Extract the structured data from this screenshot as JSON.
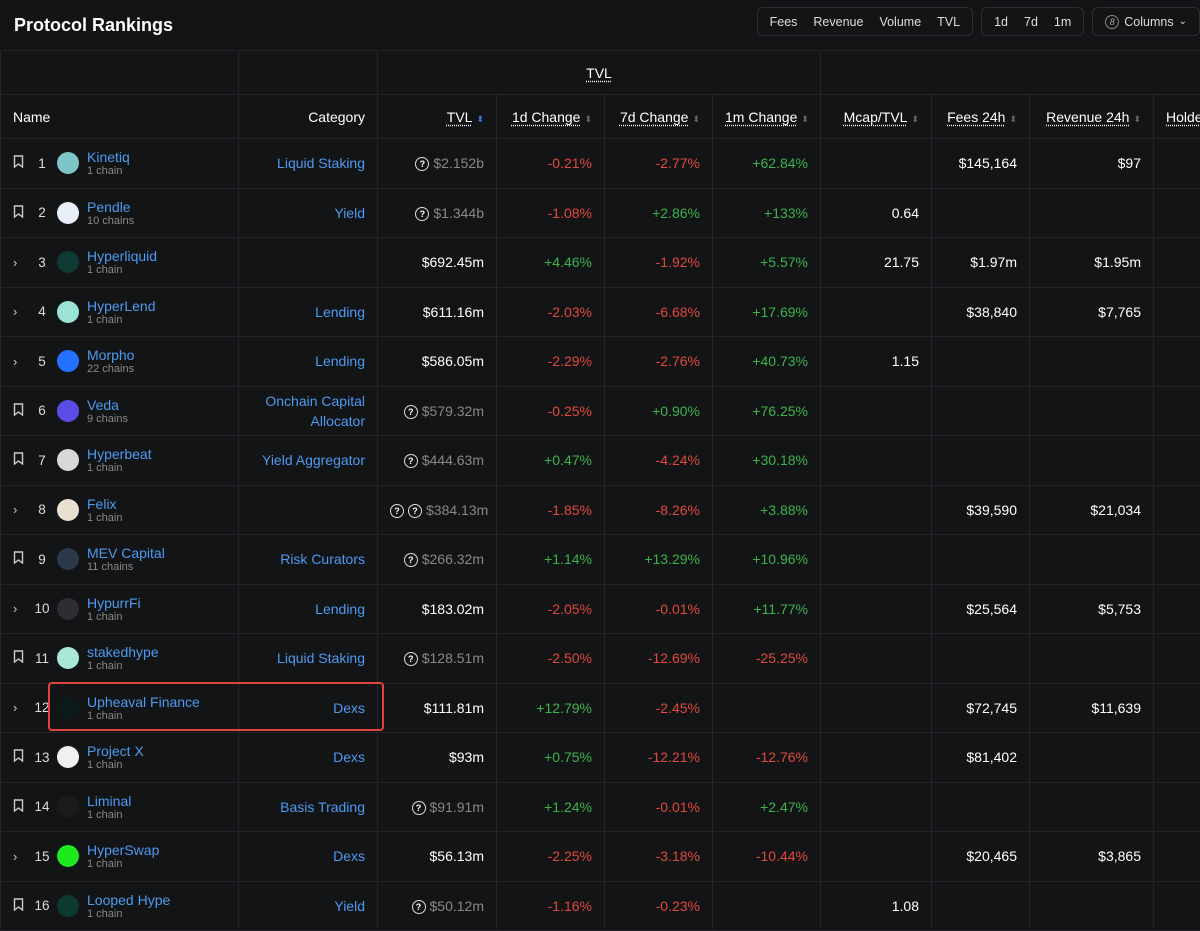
{
  "title": "Protocol Rankings",
  "metric_tabs": [
    "Fees",
    "Revenue",
    "Volume",
    "TVL"
  ],
  "period_tabs": [
    "1d",
    "7d",
    "1m"
  ],
  "columns_button": {
    "count": "8",
    "label": "Columns"
  },
  "group_header": "TVL",
  "headers": [
    "Name",
    "Category",
    "TVL",
    "1d Change",
    "7d Change",
    "1m Change",
    "Mcap/TVL",
    "Fees 24h",
    "Revenue 24h",
    "Holders"
  ],
  "rows": [
    {
      "icon": "bookmark",
      "rank": "1",
      "name": "Kinetiq",
      "chains": "1 chain",
      "cat": "Liquid Staking",
      "q": 1,
      "tvl": "$2.152b",
      "d1": "-0.21%",
      "d7": "-2.77%",
      "m1": "+62.84%",
      "mcap": "",
      "fees": "$145,164",
      "rev": "$97",
      "color": "#7fc4c9"
    },
    {
      "icon": "bookmark",
      "rank": "2",
      "name": "Pendle",
      "chains": "10 chains",
      "cat": "Yield",
      "q": 1,
      "tvl": "$1.344b",
      "d1": "-1.08%",
      "d7": "+2.86%",
      "m1": "+133%",
      "mcap": "0.64",
      "fees": "",
      "rev": "",
      "color": "#e8eef8"
    },
    {
      "icon": "chevron",
      "rank": "3",
      "name": "Hyperliquid",
      "chains": "1 chain",
      "cat": "",
      "q": 0,
      "tvl": "$692.45m",
      "d1": "+4.46%",
      "d7": "-1.92%",
      "m1": "+5.57%",
      "mcap": "21.75",
      "fees": "$1.97m",
      "rev": "$1.95m",
      "color": "#0f3a33"
    },
    {
      "icon": "chevron",
      "rank": "4",
      "name": "HyperLend",
      "chains": "1 chain",
      "cat": "Lending",
      "q": 0,
      "tvl": "$611.16m",
      "d1": "-2.03%",
      "d7": "-6.68%",
      "m1": "+17.69%",
      "mcap": "",
      "fees": "$38,840",
      "rev": "$7,765",
      "color": "#9be3d6"
    },
    {
      "icon": "chevron",
      "rank": "5",
      "name": "Morpho",
      "chains": "22 chains",
      "cat": "Lending",
      "q": 0,
      "tvl": "$586.05m",
      "d1": "-2.29%",
      "d7": "-2.76%",
      "m1": "+40.73%",
      "mcap": "1.15",
      "fees": "",
      "rev": "",
      "color": "#2470ff"
    },
    {
      "icon": "bookmark",
      "rank": "6",
      "name": "Veda",
      "chains": "9 chains",
      "cat": "Onchain Capital Allocator",
      "q": 1,
      "tvl": "$579.32m",
      "d1": "-0.25%",
      "d7": "+0.90%",
      "m1": "+76.25%",
      "mcap": "",
      "fees": "",
      "rev": "",
      "color": "#5a4de6"
    },
    {
      "icon": "bookmark",
      "rank": "7",
      "name": "Hyperbeat",
      "chains": "1 chain",
      "cat": "Yield Aggregator",
      "q": 1,
      "tvl": "$444.63m",
      "d1": "+0.47%",
      "d7": "-4.24%",
      "m1": "+30.18%",
      "mcap": "",
      "fees": "",
      "rev": "",
      "color": "#d8d8d8"
    },
    {
      "icon": "chevron",
      "rank": "8",
      "name": "Felix",
      "chains": "1 chain",
      "cat": "",
      "q": 2,
      "tvl": "$384.13m",
      "d1": "-1.85%",
      "d7": "-8.26%",
      "m1": "+3.88%",
      "mcap": "",
      "fees": "$39,590",
      "rev": "$21,034",
      "color": "#e9e1cf"
    },
    {
      "icon": "bookmark",
      "rank": "9",
      "name": "MEV Capital",
      "chains": "11 chains",
      "cat": "Risk Curators",
      "q": 1,
      "tvl": "$266.32m",
      "d1": "+1.14%",
      "d7": "+13.29%",
      "m1": "+10.96%",
      "mcap": "",
      "fees": "",
      "rev": "",
      "color": "#2a3a4a"
    },
    {
      "icon": "chevron",
      "rank": "10",
      "name": "HypurrFi",
      "chains": "1 chain",
      "cat": "Lending",
      "q": 0,
      "tvl": "$183.02m",
      "d1": "-2.05%",
      "d7": "-0.01%",
      "m1": "+11.77%",
      "mcap": "",
      "fees": "$25,564",
      "rev": "$5,753",
      "color": "#2d2d33"
    },
    {
      "icon": "bookmark",
      "rank": "11",
      "name": "stakedhype",
      "chains": "1 chain",
      "cat": "Liquid Staking",
      "q": 1,
      "tvl": "$128.51m",
      "d1": "-2.50%",
      "d7": "-12.69%",
      "m1": "-25.25%",
      "mcap": "",
      "fees": "",
      "rev": "",
      "color": "#a8e6d8"
    },
    {
      "icon": "chevron",
      "rank": "12",
      "name": "Upheaval Finance",
      "chains": "1 chain",
      "cat": "Dexs",
      "q": 0,
      "tvl": "$111.81m",
      "d1": "+12.79%",
      "d7": "-2.45%",
      "m1": "",
      "mcap": "",
      "fees": "$72,745",
      "rev": "$11,639",
      "color": "#0c1a1c"
    },
    {
      "icon": "bookmark",
      "rank": "13",
      "name": "Project X",
      "chains": "1 chain",
      "cat": "Dexs",
      "q": 0,
      "tvl": "$93m",
      "d1": "+0.75%",
      "d7": "-12.21%",
      "m1": "-12.76%",
      "mcap": "",
      "fees": "$81,402",
      "rev": "",
      "color": "#f0f0f0"
    },
    {
      "icon": "bookmark",
      "rank": "14",
      "name": "Liminal",
      "chains": "1 chain",
      "cat": "Basis Trading",
      "q": 1,
      "tvl": "$91.91m",
      "d1": "+1.24%",
      "d7": "-0.01%",
      "m1": "+2.47%",
      "mcap": "",
      "fees": "",
      "rev": "",
      "color": "#1a1a1a"
    },
    {
      "icon": "chevron",
      "rank": "15",
      "name": "HyperSwap",
      "chains": "1 chain",
      "cat": "Dexs",
      "q": 0,
      "tvl": "$56.13m",
      "d1": "-2.25%",
      "d7": "-3.18%",
      "m1": "-10.44%",
      "mcap": "",
      "fees": "$20,465",
      "rev": "$3,865",
      "color": "#1ee81e"
    },
    {
      "icon": "bookmark",
      "rank": "16",
      "name": "Looped Hype",
      "chains": "1 chain",
      "cat": "Yield",
      "q": 1,
      "tvl": "$50.12m",
      "d1": "-1.16%",
      "d7": "-0.23%",
      "m1": "",
      "mcap": "1.08",
      "fees": "",
      "rev": "",
      "color": "#0d3a30"
    }
  ]
}
